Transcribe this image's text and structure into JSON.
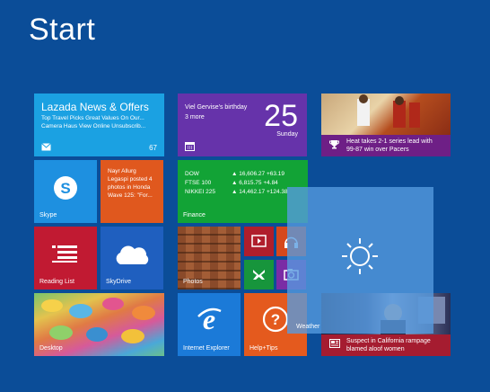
{
  "start": {
    "title": "Start"
  },
  "tiles": {
    "lazada": {
      "heading": "Lazada News & Offers",
      "line1": "Top Travel Picks Great Values On Our...",
      "line2": "Camera Haus View Online Unsubscrib...",
      "count": "67",
      "icon": "mail-icon"
    },
    "calendar": {
      "event": "Viel Gervise's birthday",
      "more": "3 more",
      "day": "25",
      "weekday": "Sunday",
      "icon": "calendar-icon"
    },
    "sports": {
      "headline_line1": "Heat takes 2-1 series lead with",
      "headline_line2": "99-87 win over Pacers",
      "icon": "trophy-icon"
    },
    "skype": {
      "label": "Skype",
      "icon": "skype-icon"
    },
    "people": {
      "line1": "Nayr Allurg",
      "line2": "Legaspi posted 4",
      "line3": "photos in Honda",
      "line4": "Wave 125: \"For..."
    },
    "finance": {
      "label": "Finance",
      "rows": [
        {
          "name": "DOW",
          "value": "▲ 16,606.27 +63.19"
        },
        {
          "name": "FTSE 100",
          "value": "▲ 6,815.75 +4.84"
        },
        {
          "name": "NIKKEI 225",
          "value": "▲ 14,462.17 +124.38"
        }
      ]
    },
    "weather": {
      "label": "Weather",
      "icon": "sun-icon"
    },
    "reading": {
      "label": "Reading List",
      "icon": "reading-list-icon"
    },
    "skydrive": {
      "label": "SkyDrive",
      "icon": "cloud-icon"
    },
    "photos": {
      "label": "Photos"
    },
    "video": {
      "icon": "video-icon"
    },
    "music": {
      "icon": "headphones-icon"
    },
    "games": {
      "icon": "xbox-icon"
    },
    "camera": {
      "icon": "camera-icon"
    },
    "desktop": {
      "label": "Desktop"
    },
    "ie": {
      "label": "Internet Explorer",
      "icon": "ie-icon"
    },
    "help": {
      "label": "Help+Tips",
      "icon": "help-icon"
    },
    "news": {
      "headline_line1": "Suspect in California rampage",
      "headline_line2": "blamed aloof women",
      "icon": "news-icon"
    }
  }
}
